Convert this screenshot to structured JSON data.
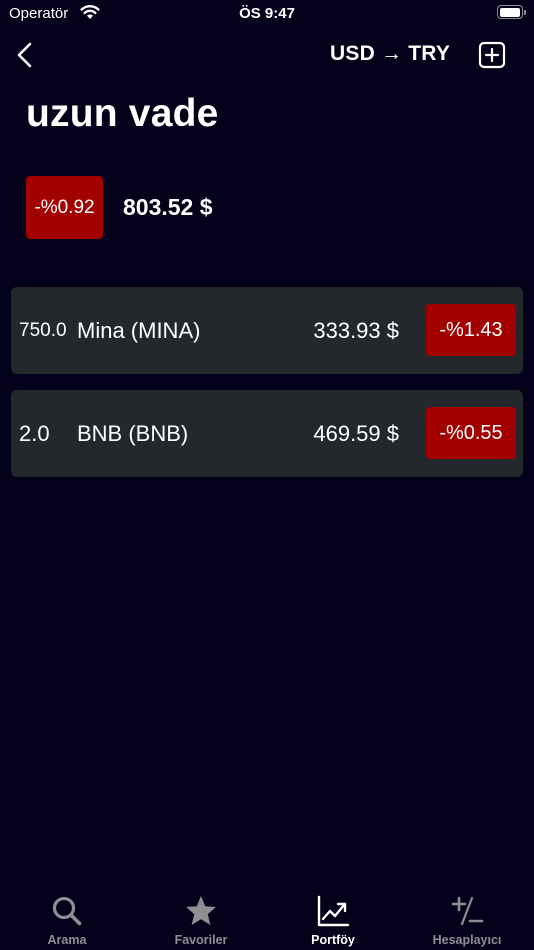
{
  "status_bar": {
    "carrier": "Operatör",
    "time": "ÖS 9:47"
  },
  "header": {
    "currency_toggle": "USD → TRY",
    "title": "uzun vade"
  },
  "summary": {
    "change": "-%0.92",
    "total": "803.52 $"
  },
  "holdings": [
    {
      "quantity": "750.0",
      "name": "Mina (MINA)",
      "value": "333.93 $",
      "change": "-%1.43"
    },
    {
      "quantity": "2.0",
      "name": "BNB (BNB)",
      "value": "469.59 $",
      "change": "-%0.55"
    }
  ],
  "tabs": [
    {
      "label": "Arama",
      "icon": "search-icon",
      "active": false
    },
    {
      "label": "Favoriler",
      "icon": "star-icon",
      "active": false
    },
    {
      "label": "Portföy",
      "icon": "chart-line-icon",
      "active": true
    },
    {
      "label": "Hesaplayıcı",
      "icon": "plus-minus-icon",
      "active": false
    }
  ],
  "colors": {
    "background": "#03021a",
    "card": "#23282d",
    "negative": "#a30000",
    "tab_inactive": "#8e8e93",
    "tab_active": "#ffffff"
  }
}
